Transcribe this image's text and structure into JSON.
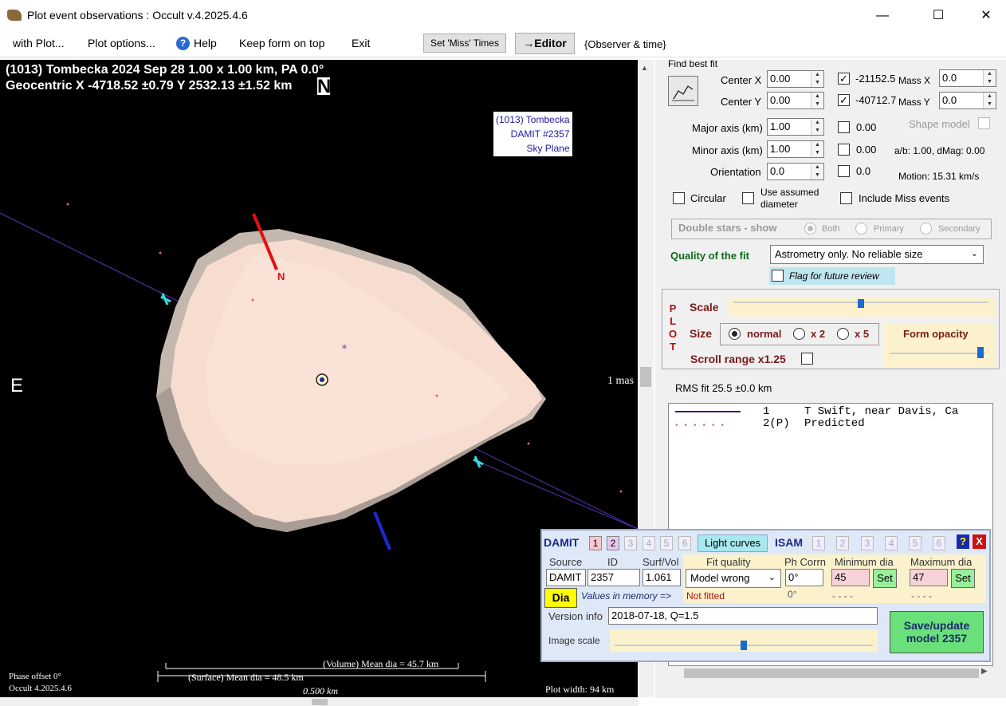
{
  "window": {
    "title": "Plot event observations : Occult v.4.2025.4.6",
    "minimize": "—",
    "maximize": "☐",
    "close": "✕"
  },
  "menu": {
    "with_plot": "with Plot...",
    "plot_options": "Plot options...",
    "help": "Help",
    "keep_on_top": "Keep form on top",
    "exit": "Exit",
    "set_miss": "Set 'Miss' Times",
    "editor": "→Editor",
    "observer_time": "{Observer & time}"
  },
  "plot": {
    "header1": "(1013) Tombecka  2024 Sep 28   1.00 x 1.00 km,  PA 0.0°",
    "header2": "Geocentric  X  -4718.52 ±0.79  Y  2532.13 ±1.52 km",
    "north_big": "N",
    "east": "E",
    "info_box": [
      "(1013) Tombecka",
      "DAMIT #2357",
      "Sky Plane"
    ],
    "north_mark": "N",
    "one_mas": "1 mas",
    "phase_offset": "Phase offset 0°",
    "occult_ver": "Occult 4.2025.4.6",
    "volume_dia": "(Volume) Mean dia = 45.7 km",
    "surface_dia": "(Surface) Mean dia = 48.5 km",
    "scale_bar": "0.500 km",
    "plot_width": "Plot width: 94 km"
  },
  "fit": {
    "group": "Find best fit",
    "center_x_label": "Center X",
    "center_x": "0.00",
    "center_y_label": "Center Y",
    "center_y": "0.00",
    "cx_checked_val": "-21152.5",
    "cy_checked_val": "-40712.7",
    "mass_x_label": "Mass X",
    "mass_x": "0.0",
    "mass_y_label": "Mass Y",
    "mass_y": "0.0",
    "major_label": "Major axis (km)",
    "major": "1.00",
    "major_val": "0.00",
    "minor_label": "Minor axis (km)",
    "minor": "1.00",
    "minor_val": "0.00",
    "orient_label": "Orientation",
    "orient": "0.0",
    "orient_val": "0.0",
    "shape_model": "Shape model",
    "ab": "a/b: 1.00, dMag: 0.00",
    "motion": "Motion: 15.31 km/s",
    "circular": "Circular",
    "use_assumed": "Use assumed diameter",
    "include_miss": "Include Miss events",
    "double_stars": "Double stars - show",
    "both": "Both",
    "primary": "Primary",
    "secondary": "Secondary",
    "quality_label": "Quality of the fit",
    "quality_value": "Astrometry only. No reliable size",
    "flag_review": "Flag for future review"
  },
  "plotctl": {
    "plot_letters": [
      "P",
      "L",
      "O",
      "T"
    ],
    "scale": "Scale",
    "scale_level": 0.5,
    "size": "Size",
    "normal": "normal",
    "x2": "x 2",
    "x5": "x 5",
    "form_opacity": "Form opacity",
    "opacity_level": 0.95,
    "scroll_range": "Scroll range x1.25"
  },
  "rms": "RMS fit 25.5 ±0.0 km",
  "legend": [
    {
      "num": "1",
      "name": "T Swift, near Davis, Ca",
      "color": "#3a1a7a"
    },
    {
      "num": "2(P)",
      "name": "Predicted",
      "color": "#e07090"
    }
  ],
  "damit": {
    "title": "DAMIT",
    "models": [
      "1",
      "2",
      "3",
      "4",
      "5",
      "6"
    ],
    "light_curves": "Light curves",
    "isam": "ISAM",
    "isam_models": [
      "1",
      "2",
      "3",
      "4",
      "5",
      "6"
    ],
    "help": "?",
    "close": "X",
    "source_label": "Source",
    "id_label": "ID",
    "surfvol_label": "Surf/Vol",
    "source": "DAMIT",
    "id": "2357",
    "surfvol": "1.061",
    "fit_quality_label": "Fit quality",
    "fit_quality": "Model wrong",
    "ph_corr_label": "Ph Corrn",
    "ph_corr": "0°",
    "ph_corr_mem": "0°",
    "min_dia_label": "Minimum dia",
    "min_dia": "45",
    "min_dia_mem": "- - - -",
    "max_dia_label": "Maximum dia",
    "max_dia": "47",
    "max_dia_mem": "- - - -",
    "set": "Set",
    "dia_btn": "Dia",
    "values_mem": "Values in memory =>",
    "not_fitted": "Not fitted",
    "version_label": "Version info",
    "version": "2018-07-18, Q=1.5",
    "image_scale": "Image scale",
    "image_scale_level": 0.5,
    "save": "Save/update model 2357"
  }
}
